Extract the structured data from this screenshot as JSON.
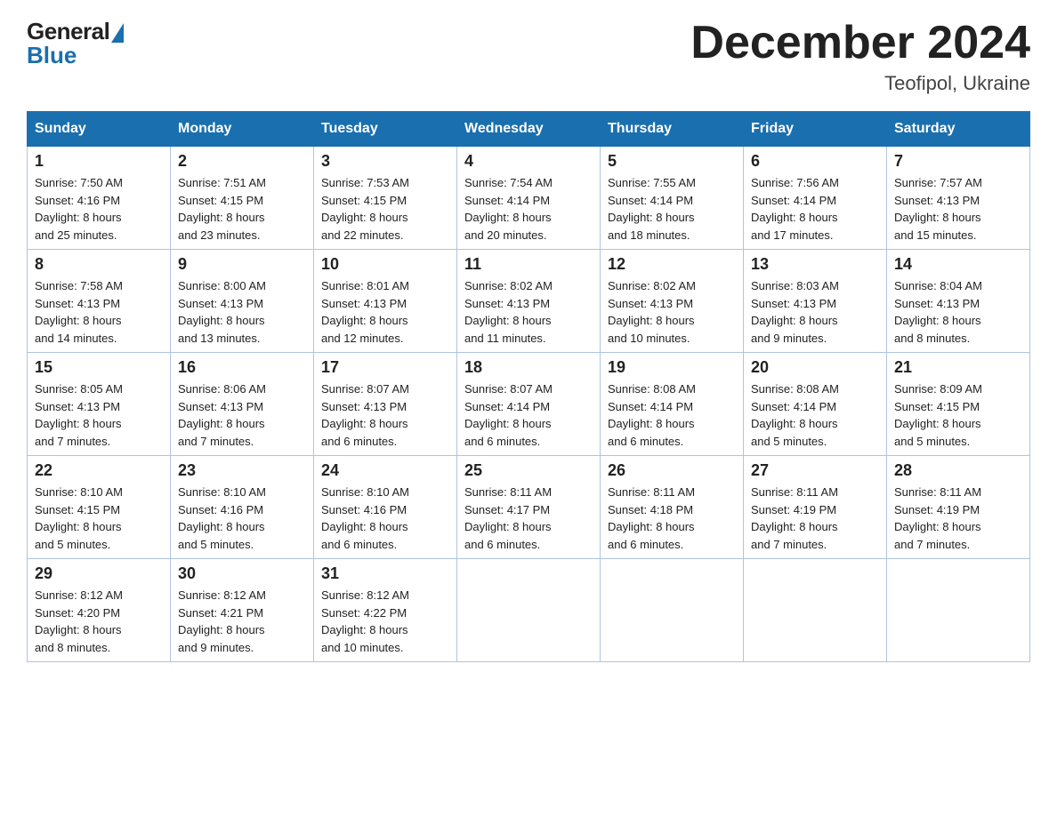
{
  "header": {
    "logo_general": "General",
    "logo_blue": "Blue",
    "month_title": "December 2024",
    "location": "Teofipol, Ukraine"
  },
  "weekdays": [
    "Sunday",
    "Monday",
    "Tuesday",
    "Wednesday",
    "Thursday",
    "Friday",
    "Saturday"
  ],
  "weeks": [
    [
      {
        "day": "1",
        "sunrise": "7:50 AM",
        "sunset": "4:16 PM",
        "daylight": "8 hours and 25 minutes."
      },
      {
        "day": "2",
        "sunrise": "7:51 AM",
        "sunset": "4:15 PM",
        "daylight": "8 hours and 23 minutes."
      },
      {
        "day": "3",
        "sunrise": "7:53 AM",
        "sunset": "4:15 PM",
        "daylight": "8 hours and 22 minutes."
      },
      {
        "day": "4",
        "sunrise": "7:54 AM",
        "sunset": "4:14 PM",
        "daylight": "8 hours and 20 minutes."
      },
      {
        "day": "5",
        "sunrise": "7:55 AM",
        "sunset": "4:14 PM",
        "daylight": "8 hours and 18 minutes."
      },
      {
        "day": "6",
        "sunrise": "7:56 AM",
        "sunset": "4:14 PM",
        "daylight": "8 hours and 17 minutes."
      },
      {
        "day": "7",
        "sunrise": "7:57 AM",
        "sunset": "4:13 PM",
        "daylight": "8 hours and 15 minutes."
      }
    ],
    [
      {
        "day": "8",
        "sunrise": "7:58 AM",
        "sunset": "4:13 PM",
        "daylight": "8 hours and 14 minutes."
      },
      {
        "day": "9",
        "sunrise": "8:00 AM",
        "sunset": "4:13 PM",
        "daylight": "8 hours and 13 minutes."
      },
      {
        "day": "10",
        "sunrise": "8:01 AM",
        "sunset": "4:13 PM",
        "daylight": "8 hours and 12 minutes."
      },
      {
        "day": "11",
        "sunrise": "8:02 AM",
        "sunset": "4:13 PM",
        "daylight": "8 hours and 11 minutes."
      },
      {
        "day": "12",
        "sunrise": "8:02 AM",
        "sunset": "4:13 PM",
        "daylight": "8 hours and 10 minutes."
      },
      {
        "day": "13",
        "sunrise": "8:03 AM",
        "sunset": "4:13 PM",
        "daylight": "8 hours and 9 minutes."
      },
      {
        "day": "14",
        "sunrise": "8:04 AM",
        "sunset": "4:13 PM",
        "daylight": "8 hours and 8 minutes."
      }
    ],
    [
      {
        "day": "15",
        "sunrise": "8:05 AM",
        "sunset": "4:13 PM",
        "daylight": "8 hours and 7 minutes."
      },
      {
        "day": "16",
        "sunrise": "8:06 AM",
        "sunset": "4:13 PM",
        "daylight": "8 hours and 7 minutes."
      },
      {
        "day": "17",
        "sunrise": "8:07 AM",
        "sunset": "4:13 PM",
        "daylight": "8 hours and 6 minutes."
      },
      {
        "day": "18",
        "sunrise": "8:07 AM",
        "sunset": "4:14 PM",
        "daylight": "8 hours and 6 minutes."
      },
      {
        "day": "19",
        "sunrise": "8:08 AM",
        "sunset": "4:14 PM",
        "daylight": "8 hours and 6 minutes."
      },
      {
        "day": "20",
        "sunrise": "8:08 AM",
        "sunset": "4:14 PM",
        "daylight": "8 hours and 5 minutes."
      },
      {
        "day": "21",
        "sunrise": "8:09 AM",
        "sunset": "4:15 PM",
        "daylight": "8 hours and 5 minutes."
      }
    ],
    [
      {
        "day": "22",
        "sunrise": "8:10 AM",
        "sunset": "4:15 PM",
        "daylight": "8 hours and 5 minutes."
      },
      {
        "day": "23",
        "sunrise": "8:10 AM",
        "sunset": "4:16 PM",
        "daylight": "8 hours and 5 minutes."
      },
      {
        "day": "24",
        "sunrise": "8:10 AM",
        "sunset": "4:16 PM",
        "daylight": "8 hours and 6 minutes."
      },
      {
        "day": "25",
        "sunrise": "8:11 AM",
        "sunset": "4:17 PM",
        "daylight": "8 hours and 6 minutes."
      },
      {
        "day": "26",
        "sunrise": "8:11 AM",
        "sunset": "4:18 PM",
        "daylight": "8 hours and 6 minutes."
      },
      {
        "day": "27",
        "sunrise": "8:11 AM",
        "sunset": "4:19 PM",
        "daylight": "8 hours and 7 minutes."
      },
      {
        "day": "28",
        "sunrise": "8:11 AM",
        "sunset": "4:19 PM",
        "daylight": "8 hours and 7 minutes."
      }
    ],
    [
      {
        "day": "29",
        "sunrise": "8:12 AM",
        "sunset": "4:20 PM",
        "daylight": "8 hours and 8 minutes."
      },
      {
        "day": "30",
        "sunrise": "8:12 AM",
        "sunset": "4:21 PM",
        "daylight": "8 hours and 9 minutes."
      },
      {
        "day": "31",
        "sunrise": "8:12 AM",
        "sunset": "4:22 PM",
        "daylight": "8 hours and 10 minutes."
      },
      null,
      null,
      null,
      null
    ]
  ],
  "labels": {
    "sunrise": "Sunrise:",
    "sunset": "Sunset:",
    "daylight": "Daylight:"
  }
}
